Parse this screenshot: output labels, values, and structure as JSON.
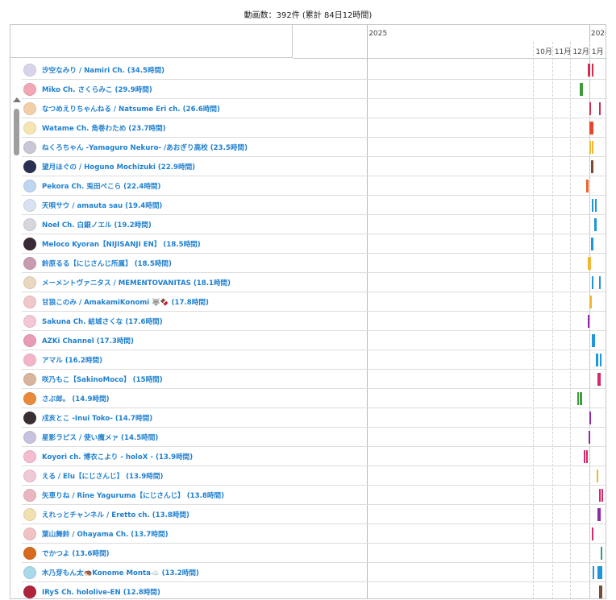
{
  "summary": "動画数：392件 (累計 84日12時間)",
  "timeline": {
    "start": "2024-09-02",
    "end": "2026-01-29",
    "years": [
      {
        "label": "2025",
        "date": "2025-01-01"
      },
      {
        "label": "2026",
        "date": "2026-01-01"
      }
    ],
    "months": [
      {
        "label": "10月",
        "date": "2025-10-01"
      },
      {
        "label": "11月",
        "date": "2025-11-01"
      },
      {
        "label": "12月",
        "date": "2025-12-01"
      },
      {
        "label": "1月",
        "date": "2026-01-01"
      }
    ]
  },
  "channels": [
    {
      "label": "汐空なみり / Namiri Ch. (34.5時間)",
      "avatar_color": "#d9d4ea",
      "bar_color": "#d62c4f",
      "dates": [
        "2025-12-31",
        "2026-01-01",
        "2026-01-06",
        "2026-01-07"
      ]
    },
    {
      "label": "Miko Ch. さくらみこ (29.9時間)",
      "avatar_color": "#f2a7b5",
      "bar_color": "#3f9a3c",
      "dates": [
        "2025-12-18",
        "2025-12-19",
        "2025-12-20"
      ]
    },
    {
      "label": "なつめえりちゃんねる / Natsume Eri ch. (26.6時間)",
      "avatar_color": "#f3cfa8",
      "bar_color": "#d62c4f",
      "dates": [
        "2026-01-03",
        "2026-01-18"
      ]
    },
    {
      "label": "Watame Ch. 角巻わため (23.7時間)",
      "avatar_color": "#f6e4b2",
      "bar_color": "#e8442a",
      "dates": [
        "2026-01-03",
        "2026-01-05",
        "2026-01-06"
      ]
    },
    {
      "label": "ねくろちゃん -Yamaguro Nekuro- /あおぎり高校 (23.5時間)",
      "avatar_color": "#c9c6d6",
      "bar_color": "#f2b632",
      "dates": [
        "2026-01-03",
        "2026-01-06"
      ]
    },
    {
      "label": "望月ほぐの / Hoguno Mochizuki (22.9時間)",
      "avatar_color": "#2b2f52",
      "bar_color": "#7b4a33",
      "dates": [
        "2026-01-05",
        "2026-01-06"
      ]
    },
    {
      "label": "Pekora Ch. 兎田ぺこら (22.4時間)",
      "avatar_color": "#bfd6f3",
      "bar_color": "#e8632a",
      "dates": [
        "2025-12-28",
        "2025-12-29",
        "2025-12-30"
      ]
    },
    {
      "label": "天唄サウ / amauta sau (19.4時間)",
      "avatar_color": "#d8e2f2",
      "bar_color": "#1e96d8",
      "dates": [
        "2026-01-06",
        "2026-01-12"
      ]
    },
    {
      "label": "Noel Ch. 白銀ノエル (19.2時間)",
      "avatar_color": "#d6d6dc",
      "bar_color": "#1e96d8",
      "dates": [
        "2026-01-10",
        "2026-01-11",
        "2026-01-12"
      ]
    },
    {
      "label": "Meloco Kyoran【NIJISANJI EN】 (18.5時間)",
      "avatar_color": "#3a2a38",
      "bar_color": "#1e96d8",
      "dates": [
        "2026-01-05",
        "2026-01-06"
      ]
    },
    {
      "label": "鈴原るる【にじさんじ所属】 (18.5時間)",
      "avatar_color": "#c99ab0",
      "bar_color": "#f2b632",
      "dates": [
        "2025-12-31",
        "2026-01-03"
      ]
    },
    {
      "label": "メーメントヴァニタス / MEMENTOVANITAS (18.1時間)",
      "avatar_color": "#e9d7bf",
      "bar_color": "#1e96d8",
      "dates": [
        "2026-01-07",
        "2026-01-18"
      ]
    },
    {
      "label": "甘狼このみ / AmakamiKonomi 🐺🍫 (17.8時間)",
      "avatar_color": "#f1c7c9",
      "bar_color": "#f2b632",
      "dates": [
        "2026-01-03",
        "2026-01-04"
      ]
    },
    {
      "label": "Sakuna Ch. 結城さくな (17.6時間)",
      "avatar_color": "#f4c7d4",
      "bar_color": "#8e2aa8",
      "dates": [
        "2025-12-31"
      ]
    },
    {
      "label": "AZKi Channel (17.3時間)",
      "avatar_color": "#e89bb5",
      "bar_color": "#1e96d8",
      "dates": [
        "2026-01-07",
        "2026-01-08",
        "2026-01-09"
      ]
    },
    {
      "label": "アマル (16.2時間)",
      "avatar_color": "#f3b6c8",
      "bar_color": "#1e96d8",
      "dates": [
        "2026-01-13",
        "2026-01-14",
        "2026-01-20"
      ]
    },
    {
      "label": "咲乃もこ【SakinoMoco】 (15時間)",
      "avatar_color": "#d8b49c",
      "bar_color": "#d6286e",
      "dates": [
        "2026-01-16",
        "2026-01-17",
        "2026-01-18"
      ]
    },
    {
      "label": "さぶ郎。 (14.9時間)",
      "avatar_color": "#e88a3a",
      "bar_color": "#3f9a3c",
      "dates": [
        "2025-12-14",
        "2025-12-18",
        "2025-12-19"
      ]
    },
    {
      "label": "戌亥とこ -Inui Toko- (14.7時間)",
      "avatar_color": "#3a2e32",
      "bar_color": "#8e2aa8",
      "dates": [
        "2026-01-03"
      ]
    },
    {
      "label": "星影ラピス / 使い魔メァ (14.5時間)",
      "avatar_color": "#c8c2e0",
      "bar_color": "#8e2aa8",
      "dates": [
        "2026-01-01"
      ]
    },
    {
      "label": "Koyori ch. 博衣こより - holoX - (13.9時間)",
      "avatar_color": "#f4bccd",
      "bar_color": "#d6286e",
      "dates": [
        "2025-12-24",
        "2025-12-28"
      ]
    },
    {
      "label": "える / Elu【にじさんじ】 (13.9時間)",
      "avatar_color": "#f0c9d6",
      "bar_color": "#f2b632",
      "dates": [
        "2026-01-14",
        "2026-01-15"
      ]
    },
    {
      "label": "矢車りね / Rine Yaguruma【にじさんじ】 (13.8時間)",
      "avatar_color": "#e8b7c2",
      "bar_color": "#d6286e",
      "dates": [
        "2026-01-18",
        "2026-01-19",
        "2026-01-22"
      ]
    },
    {
      "label": "えれっとチャンネル / Eretto ch. (13.8時間)",
      "avatar_color": "#f1e0b0",
      "bar_color": "#8e2aa8",
      "dates": [
        "2026-01-16",
        "2026-01-17",
        "2026-01-18"
      ]
    },
    {
      "label": "葉山舞鈴 / Ohayama Ch. (13.7時間)",
      "avatar_color": "#f0c2c4",
      "bar_color": "#d6286e",
      "dates": [
        "2026-01-06",
        "2026-01-07"
      ]
    },
    {
      "label": "でかつよ (13.6時間)",
      "avatar_color": "#d66a1e",
      "bar_color": "#21a07a",
      "dates": [
        "2026-01-21"
      ]
    },
    {
      "label": "木乃芽もん太🦔Konome Monta☁️ (13.2時間)",
      "avatar_color": "#a9d8e8",
      "bar_color": "#1e96d8",
      "dates": [
        "2026-01-08",
        "2026-01-16",
        "2026-01-18",
        "2026-01-20",
        "2026-01-21"
      ]
    },
    {
      "label": "IRyS Ch. hololive-EN (12.8時間)",
      "avatar_color": "#b0243a",
      "bar_color": "#7b4a33",
      "dates": [
        "2026-01-19",
        "2026-01-21"
      ]
    }
  ]
}
